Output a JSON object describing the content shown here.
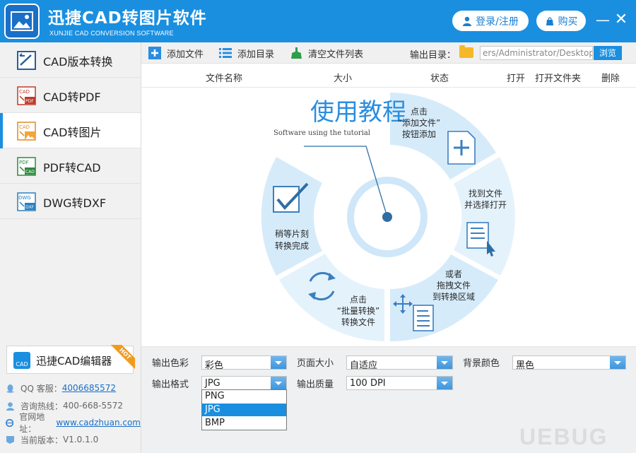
{
  "app": {
    "title": "迅捷CAD转图片软件",
    "subtitle": "XUNJIE CAD CONVERSION SOFTWARE",
    "login_label": "登录/注册",
    "buy_label": "购买",
    "minimize_glyph": "—",
    "close_glyph": "✕"
  },
  "sidebar": {
    "items": [
      {
        "label": "CAD版本转换",
        "icon": "cad-version-icon"
      },
      {
        "label": "CAD转PDF",
        "icon": "cad-to-pdf-icon"
      },
      {
        "label": "CAD转图片",
        "icon": "cad-to-image-icon",
        "active": true
      },
      {
        "label": "PDF转CAD",
        "icon": "pdf-to-cad-icon"
      },
      {
        "label": "DWG转DXF",
        "icon": "dwg-to-dxf-icon"
      }
    ],
    "editor_label": "迅捷CAD编辑器",
    "hot_badge": "HOT",
    "qq_label": "QQ 客服：",
    "qq_value": "4006685572",
    "hotline_label": "咨询热线：",
    "hotline_value": "400-668-5572",
    "website_label": "官网地址：",
    "website_value": "www.cadzhuan.com",
    "version_label": "当前版本：",
    "version_value": "V1.0.1.0"
  },
  "toolbar": {
    "add_file": "添加文件",
    "add_dir": "添加目录",
    "clear_list": "清空文件列表",
    "output_label": "输出目录：",
    "output_path": "ers/Administrator/Desktop",
    "browse": "浏览"
  },
  "columns": {
    "name": "文件名称",
    "size": "大小",
    "status": "状态",
    "open": "打开",
    "open_folder": "打开文件夹",
    "delete": "删除"
  },
  "tutorial": {
    "title": "使用教程",
    "subtitle": "Software using the tutorial",
    "step1": [
      "点击",
      "“添加文件”",
      "按钮添加"
    ],
    "step2": [
      "找到文件",
      "并选择打开"
    ],
    "step3": [
      "或者",
      "拖拽文件",
      "到转换区域"
    ],
    "step4": [
      "点击",
      "“批量转换”",
      "转换文件"
    ],
    "step5": [
      "稍等片刻",
      "转换完成"
    ]
  },
  "options": {
    "color_label": "输出色彩",
    "color_value": "彩色",
    "page_label": "页面大小",
    "page_value": "自适应",
    "bg_label": "背景颜色",
    "bg_value": "黑色",
    "format_label": "输出格式",
    "format_value": "JPG",
    "quality_label": "输出质量",
    "quality_value": "100 DPI",
    "format_options": [
      "PNG",
      "JPG",
      "BMP"
    ]
  },
  "watermark": "UEBUG",
  "colors": {
    "accent": "#1a8fe0",
    "tutorial_light": "#d8ecfa",
    "tutorial_text": "#2a6fa8"
  }
}
